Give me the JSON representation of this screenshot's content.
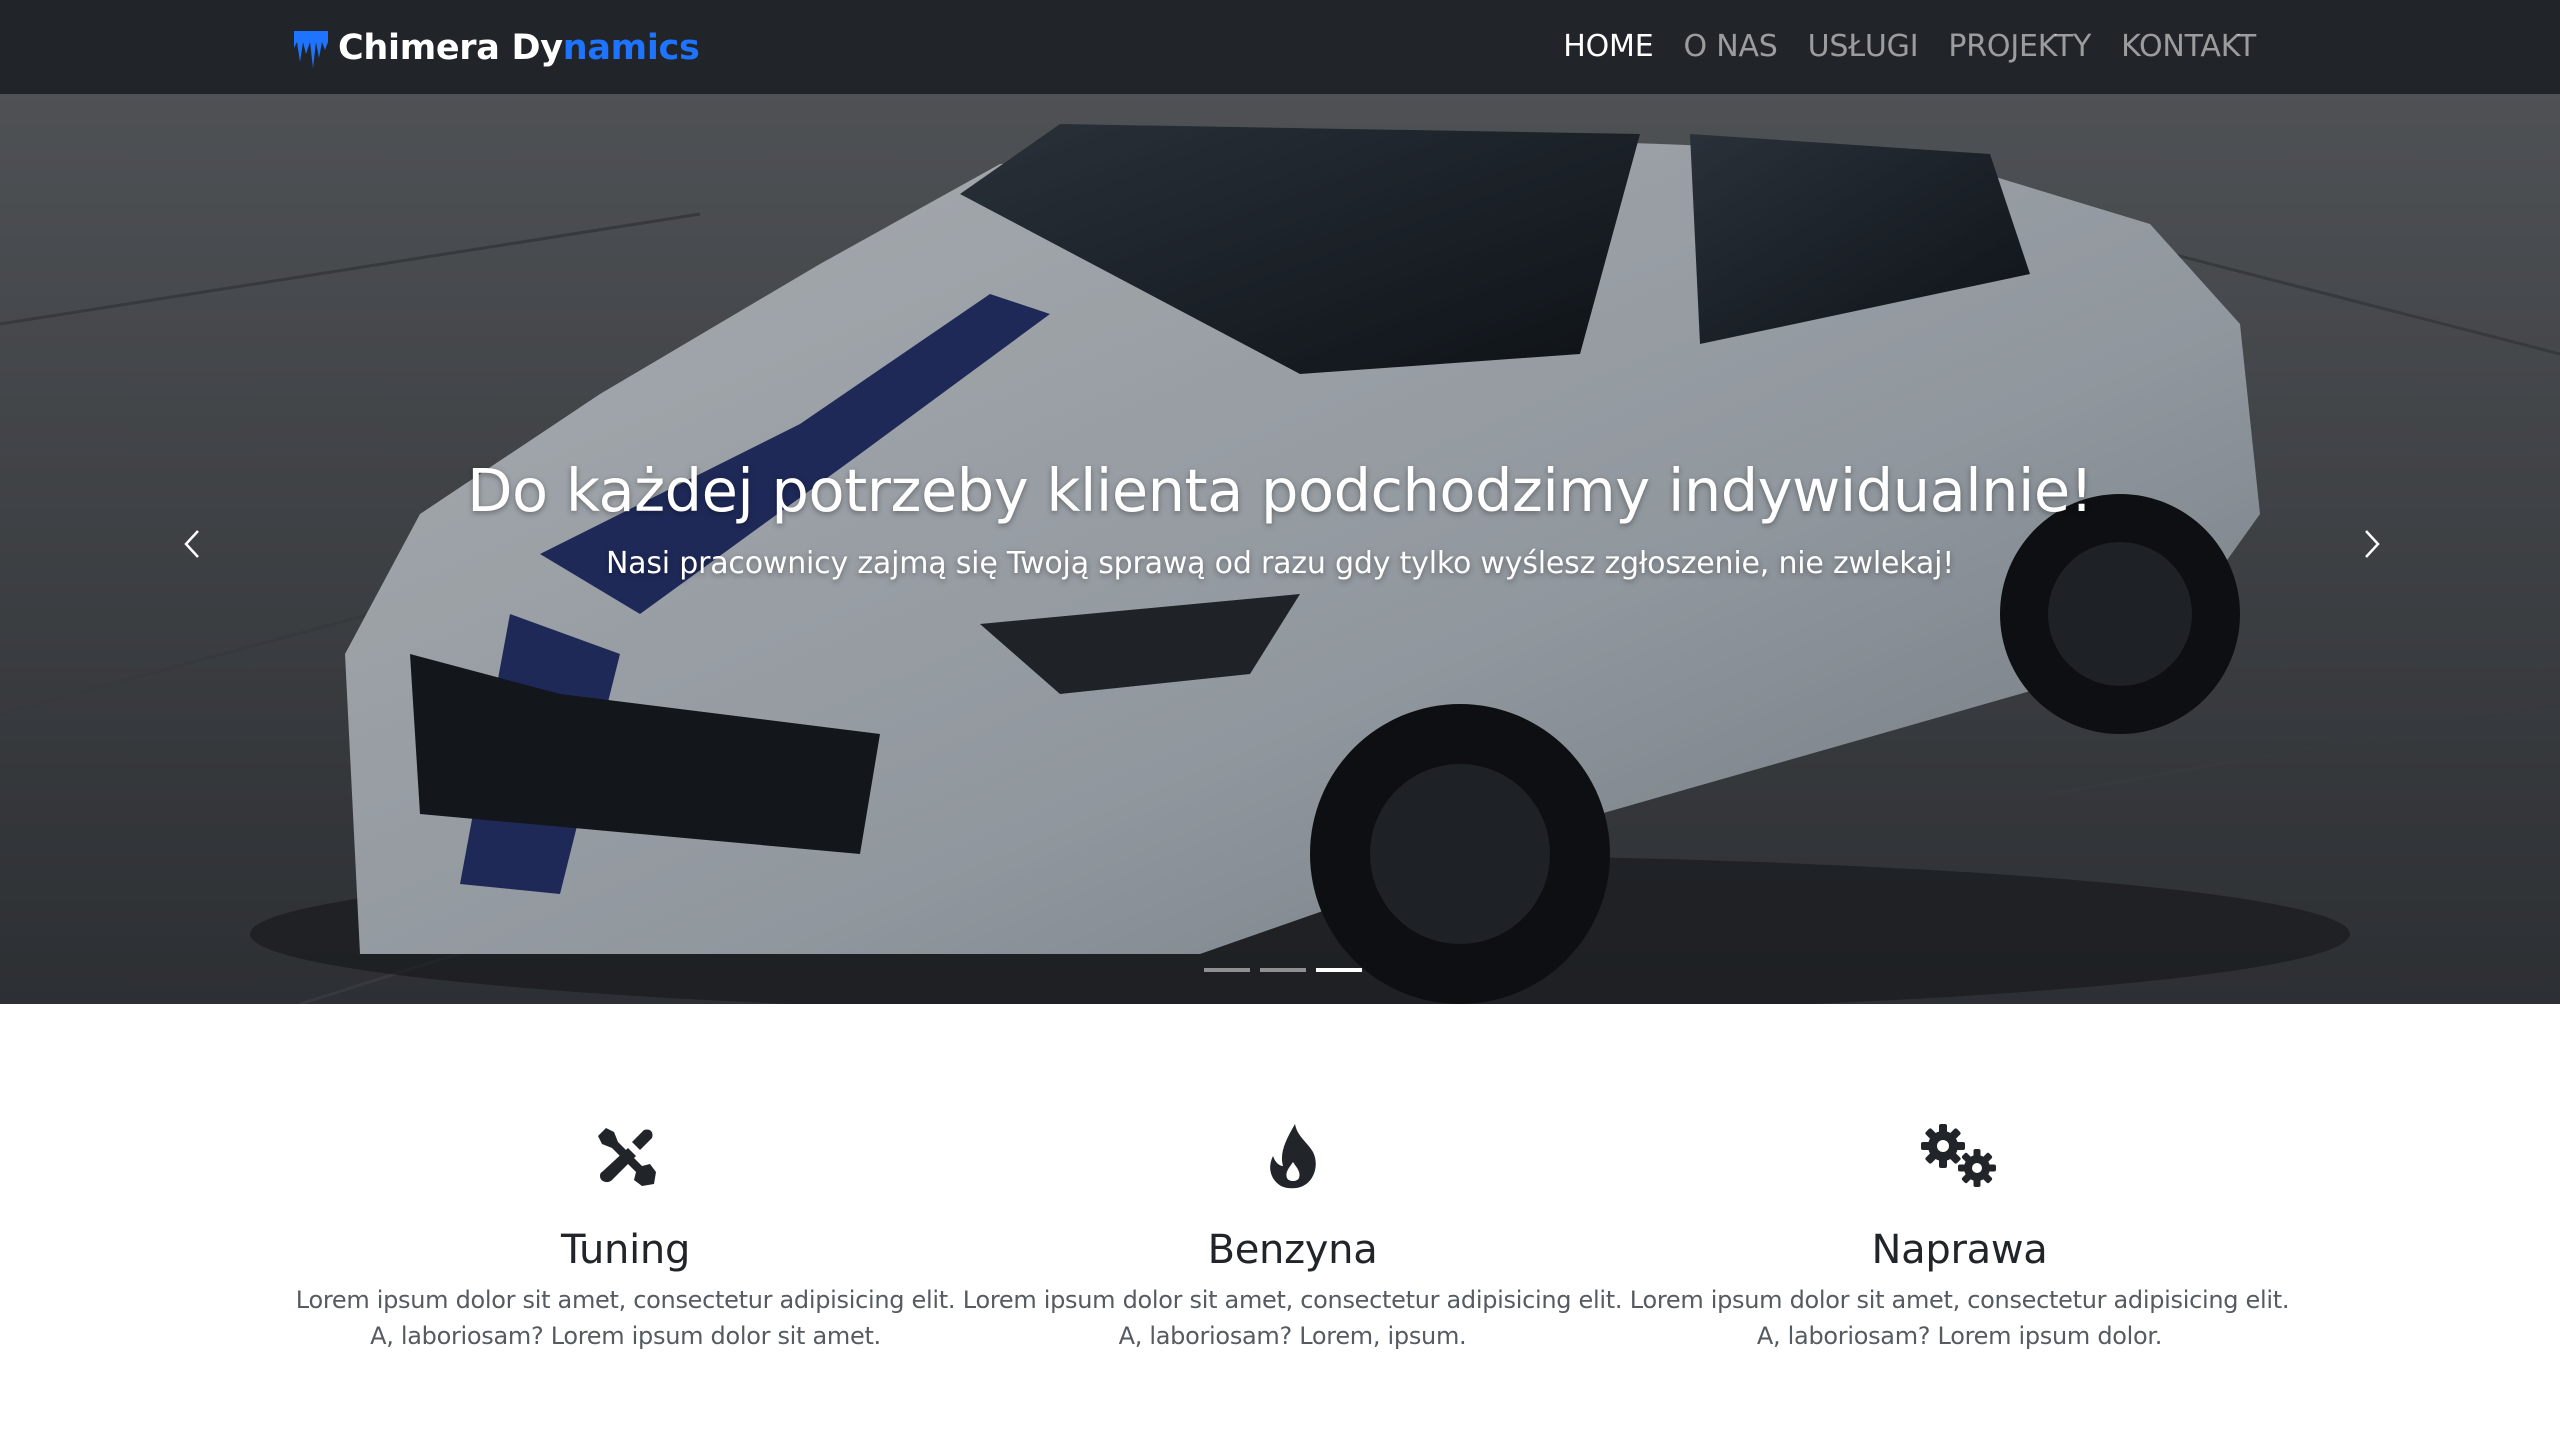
{
  "brand": {
    "name_part1": "Chimera Dy",
    "name_part2": "namics",
    "icon": "fang-logo-icon",
    "accent": "#1e73ff"
  },
  "nav": {
    "items": [
      {
        "label": "HOME",
        "active": true
      },
      {
        "label": "O NAS"
      },
      {
        "label": "USŁUGI"
      },
      {
        "label": "PROJEKTY"
      },
      {
        "label": "KONTAKT"
      }
    ]
  },
  "hero": {
    "title": "Do każdej potrzeby klienta podchodzimy indywidualnie!",
    "subtitle": "Nasi pracownicy zajmą się Twoją sprawą od razu gdy tylko wyślesz zgłoszenie, nie zwlekaj!",
    "prev_icon": "chevron-left-icon",
    "next_icon": "chevron-right-icon",
    "slides": 3,
    "active_slide": 3
  },
  "features": [
    {
      "icon": "tools-icon",
      "title": "Tuning",
      "line1": "Lorem ipsum dolor sit amet, consectetur adipisicing elit.",
      "line2": "A, laboriosam? Lorem ipsum dolor sit amet."
    },
    {
      "icon": "fire-icon",
      "title": "Benzyna",
      "line1": "Lorem ipsum dolor sit amet, consectetur adipisicing elit.",
      "line2": "A, laboriosam? Lorem, ipsum."
    },
    {
      "icon": "cogs-icon",
      "title": "Naprawa",
      "line1": "Lorem ipsum dolor sit amet, consectetur adipisicing elit.",
      "line2": "A, laboriosam? Lorem ipsum dolor."
    }
  ]
}
